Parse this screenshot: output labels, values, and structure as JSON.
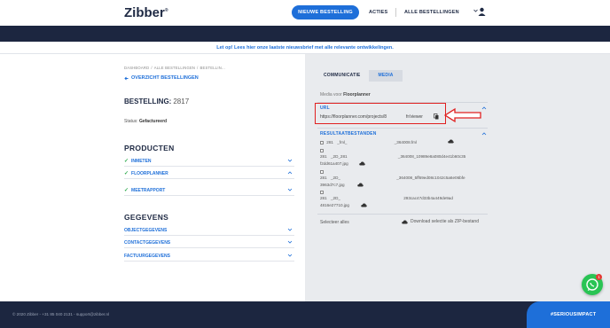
{
  "header": {
    "logo": "Zibber",
    "logo_mark": "®",
    "new_order_button": "NIEUWE BESTELLING",
    "actions_link": "ACTIES",
    "all_orders_link": "ALLE BESTELLINGEN"
  },
  "notice": "Let op! Lees hier onze laatste nieuwsbrief met alle relevante ontwikkelingen.",
  "breadcrumb": [
    "DASHBOARD",
    "/",
    "ALLE BESTELLINGEN",
    "/",
    "BESTELLIN..."
  ],
  "overview_link": "OVERZICHT BESTELLINGEN",
  "order": {
    "title": "BESTELLING:",
    "number": "2817",
    "status_label": "Status:",
    "status_value": "Gefactureerd"
  },
  "products": {
    "title": "PRODUCTEN",
    "items": [
      {
        "label": "INMETEN"
      },
      {
        "label": "FLOORPLANNER"
      },
      {
        "label": "MEETRAPPORT"
      }
    ]
  },
  "details": {
    "title": "GEGEVENS",
    "items": [
      {
        "label": "OBJECTGEGEVENS"
      },
      {
        "label": "CONTACTGEGEVENS"
      },
      {
        "label": "FACTUURGEGEVENS"
      }
    ]
  },
  "tabs": [
    {
      "label": "COMMUNICATIE"
    },
    {
      "label": "MEDIA"
    }
  ],
  "media": {
    "media_for_label": "Media voor",
    "media_for_value": "Floorplanner",
    "url_heading": "URL",
    "url_value": "https://floorplanner.com/projects/8",
    "url_suffix": "fr/viewer",
    "results_heading": "RESULTAATBESTANDEN",
    "files": [
      {
        "a": "281",
        "b": "_fml_",
        "c": "_364008.fml"
      },
      {
        "a": "281",
        "b": "_2D_281",
        "c": "_364008_10989e8a080d4e41b60c35",
        "d": "f2dd61a407.jpg"
      },
      {
        "a": "281",
        "b": "_2D_",
        "c": "_364008_5ff69ed08c1042c5a6e06bfe",
        "d": "3963d7c7.jpg"
      },
      {
        "a": "281",
        "b": "_2D_",
        "c": "293cac47d33b4a449de9ad",
        "d": "4816e27710.jpg"
      }
    ],
    "select_all": "Selecteer alles",
    "download_zip": "Download selectie als ZIP-bestand"
  },
  "footer": {
    "text": "© 2020 Zibber - +31 85 040 2131 - support@zibber.nl",
    "impact": "#SERIOUSIMPACT"
  },
  "whatsapp_badge": "1",
  "colors": {
    "brand_blue": "#1e6fd9",
    "navy": "#1c2640",
    "annotation_red": "#e02020",
    "whatsapp_green": "#29c454"
  }
}
